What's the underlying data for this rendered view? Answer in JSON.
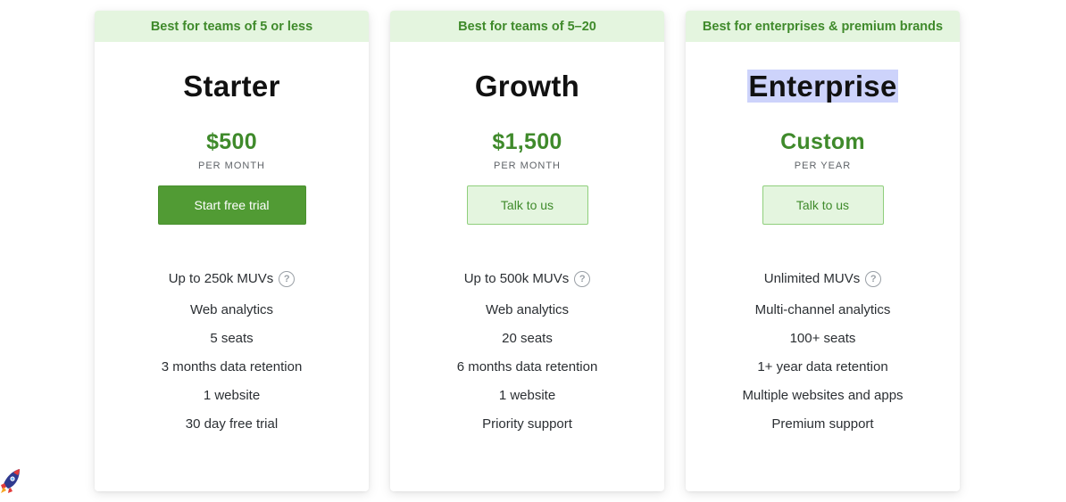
{
  "plans": [
    {
      "banner": "Best for teams of 5 or less",
      "name": "Starter",
      "price": "$500",
      "period": "PER MONTH",
      "cta": "Start free trial",
      "features": [
        "Up to 250k MUVs",
        "Web analytics",
        "5 seats",
        "3 months data retention",
        "1 website",
        "30 day free trial"
      ]
    },
    {
      "banner": "Best for teams of 5–20",
      "name": "Growth",
      "price": "$1,500",
      "period": "PER MONTH",
      "cta": "Talk to us",
      "features": [
        "Up to 500k MUVs",
        "Web analytics",
        "20 seats",
        "6 months data retention",
        "1 website",
        "Priority support"
      ]
    },
    {
      "banner": "Best for enterprises & premium brands",
      "name": "Enterprise",
      "price": "Custom",
      "period": "PER YEAR",
      "cta": "Talk to us",
      "features": [
        "Unlimited MUVs",
        "Multi-channel analytics",
        "100+ seats",
        "1+ year data retention",
        "Multiple websites and apps",
        "Premium support"
      ]
    }
  ],
  "help_glyph": "?",
  "colors": {
    "accent": "#519b34",
    "accent_text": "#3f8a2b",
    "banner_bg": "#e4f5df",
    "selection": "#cdd3fb"
  },
  "icons": {
    "help": "help-icon",
    "launcher": "rocket-icon"
  }
}
